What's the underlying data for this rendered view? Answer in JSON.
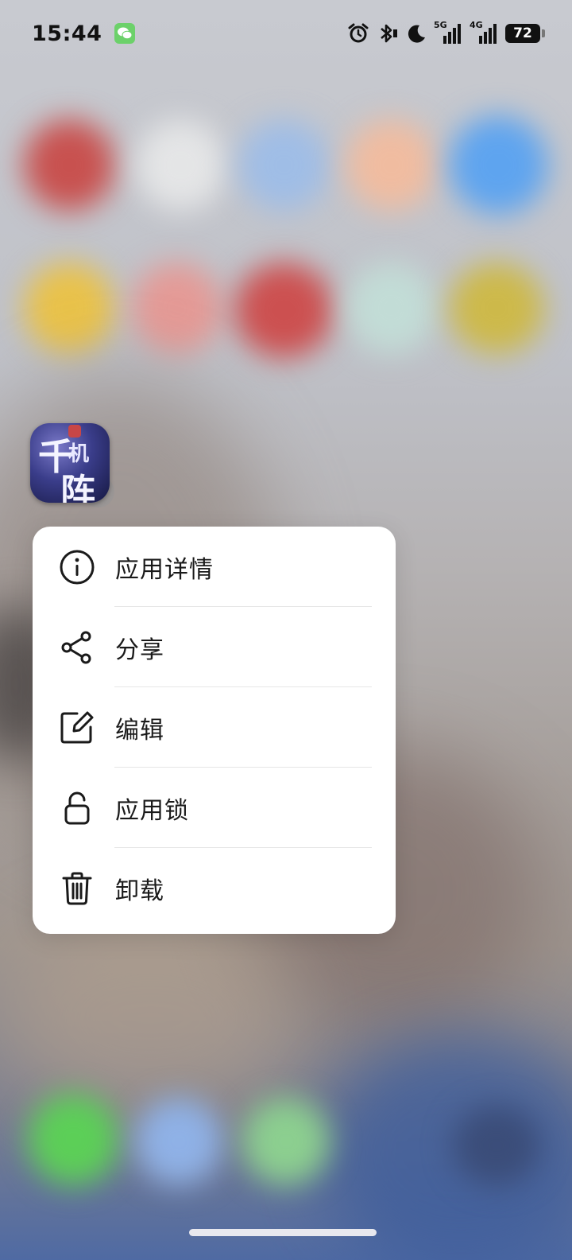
{
  "status_bar": {
    "time": "15:44",
    "wechat_icon": "wechat-icon",
    "alarm_icon": "alarm-icon",
    "bluetooth_icon": "bluetooth-icon",
    "dnd_icon": "moon-icon",
    "network1_label": "5G",
    "network2_label": "4G",
    "battery_level": "72"
  },
  "app": {
    "icon_name": "qianjizhen-app-icon"
  },
  "context_menu": {
    "items": [
      {
        "label": "应用详情",
        "icon": "info-icon"
      },
      {
        "label": "分享",
        "icon": "share-icon"
      },
      {
        "label": "编辑",
        "icon": "edit-icon"
      },
      {
        "label": "应用锁",
        "icon": "lock-icon"
      },
      {
        "label": "卸载",
        "icon": "trash-icon"
      }
    ]
  },
  "colors": {
    "menu_background": "#ffffff",
    "menu_text": "#1a1a1a",
    "wechat_green": "#6cd16a"
  }
}
